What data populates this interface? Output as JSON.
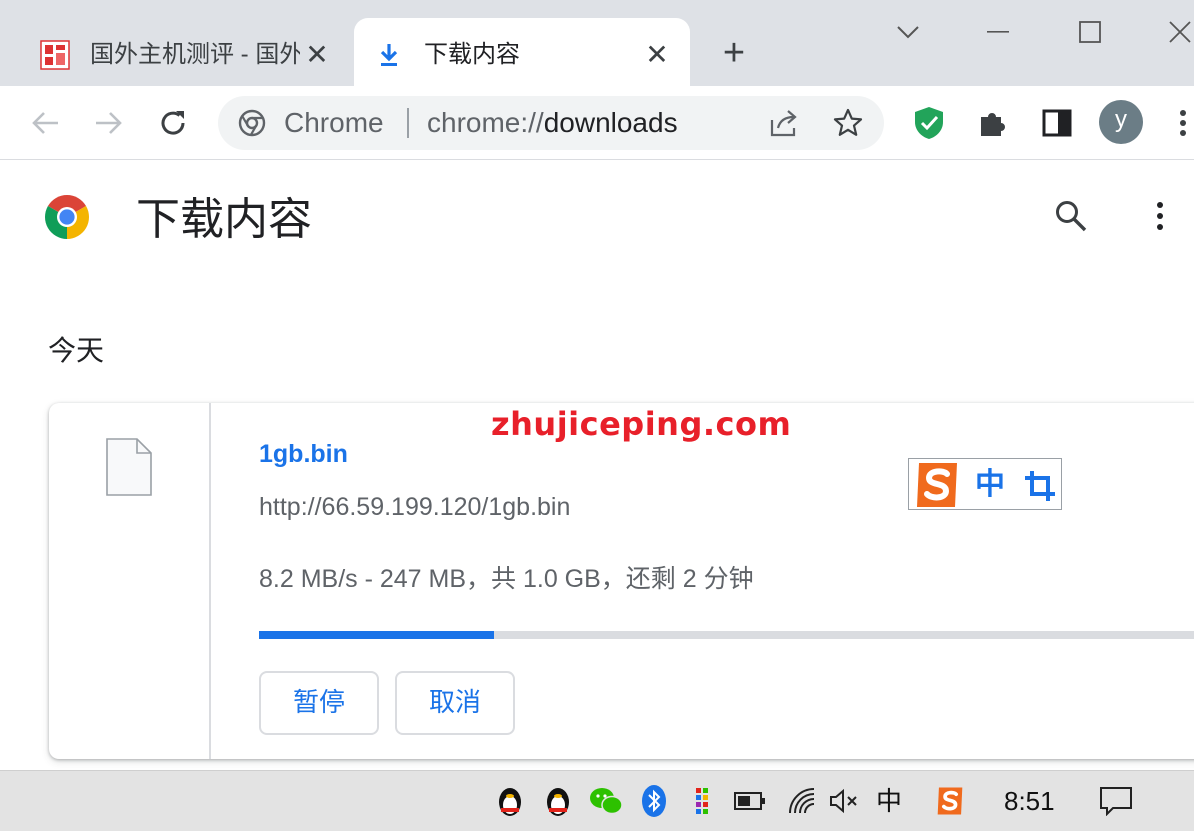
{
  "tabs": [
    {
      "title": "国外主机测评 - 国外",
      "icon": "site-favicon",
      "active": false
    },
    {
      "title": "下载内容",
      "icon": "download-icon",
      "active": true
    }
  ],
  "toolbar": {
    "omnibox_chip": "Chrome",
    "url_scheme": "chrome://",
    "url_host": "downloads",
    "profile_initial": "y"
  },
  "page": {
    "title": "下载内容",
    "date_label": "今天"
  },
  "download": {
    "file_name": "1gb.bin",
    "url": "http://66.59.199.120/1gb.bin",
    "status": "8.2 MB/s - 247 MB，共 1.0 GB，还剩 2 分钟",
    "progress_fraction": 0.247,
    "pause_label": "暂停",
    "cancel_label": "取消"
  },
  "watermark": "zhujiceping.com",
  "ime": {
    "mode_label": "中"
  },
  "taskbar": {
    "input_mode": "中",
    "clock": "8:51"
  },
  "colors": {
    "accent": "#1a73e8",
    "watermark": "#e8202a"
  }
}
